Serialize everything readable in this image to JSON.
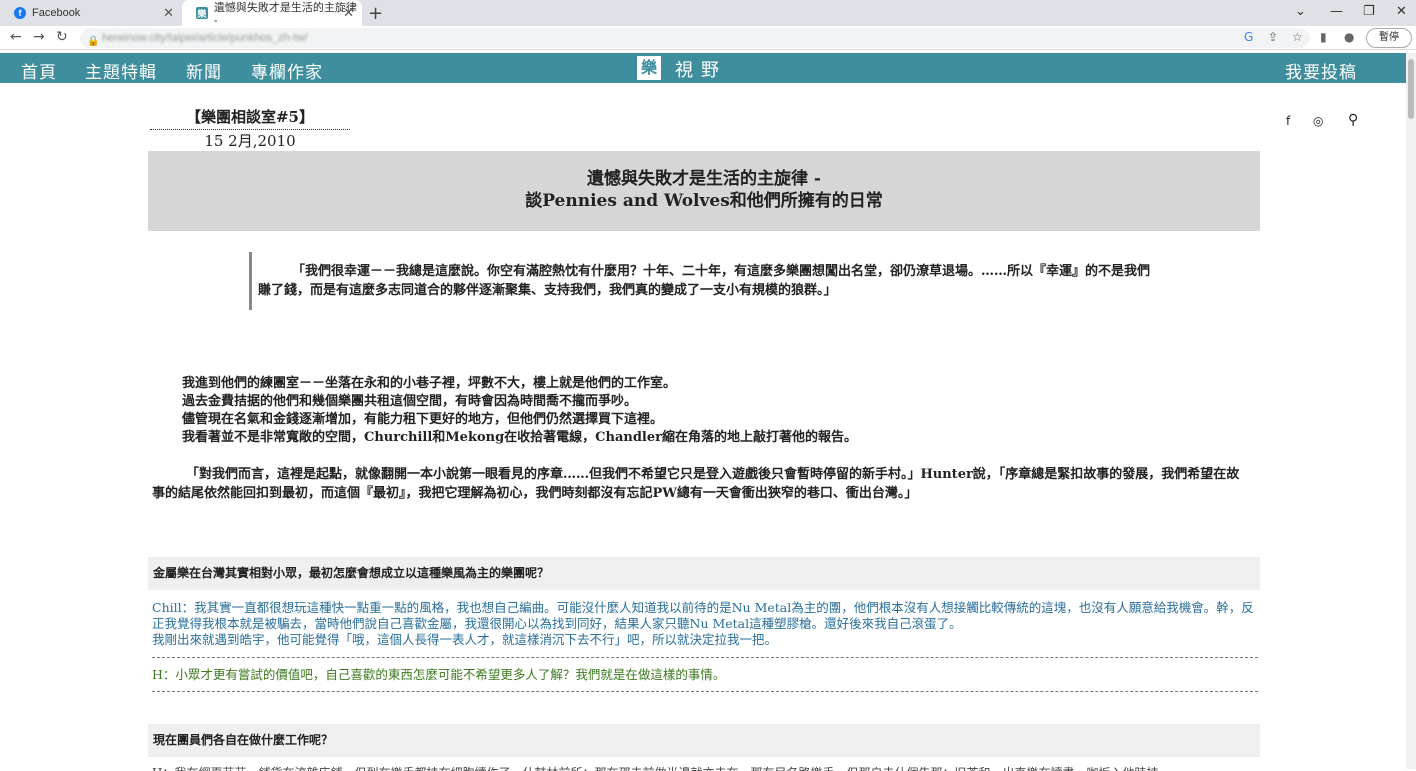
{
  "browser": {
    "tabs": [
      {
        "label": "Facebook"
      },
      {
        "label": "遺憾與失敗才是生活的主旋律 -"
      }
    ],
    "url": "hereinow.city/taipei/article/punkhos_zh-tw/",
    "paused_label": "暫停"
  },
  "site_nav": {
    "items": [
      "首頁",
      "主題特輯",
      "新聞",
      "專欄作家"
    ],
    "logo_char": "樂",
    "logo_text": "視野",
    "submit_label": "我要投稿"
  },
  "article": {
    "series": "【樂團相談室#5】",
    "date": "15 2月,2010",
    "title_line1": "遺憾與失敗才是生活的主旋律 -",
    "title_line2": "談Pennies and Wolves和他們所擁有的日常",
    "quote": "「我們很幸運－－我總是這麼說。你空有滿腔熱忱有什麼用？十年、二十年，有這麼多樂團想闖出名堂，卻仍潦草退場。……所以『幸運』的不是我們賺了錢，而是有這麼多志同道合的夥伴逐漸聚集、支持我們，我們真的變成了一支小有規模的狼群。」",
    "para_lines": [
      "我進到他們的練團室－－坐落在永和的小巷子裡，坪數不大，樓上就是他們的工作室。",
      "過去金費拮据的他們和幾個樂團共租這個空間，有時會因為時間喬不攏而爭吵。",
      "儘管現在名氣和金錢逐漸增加，有能力租下更好的地方，但他們仍然選擇買下這裡。",
      "我看著並不是非常寬敞的空間，Churchill和Mekong在收拾著電線，Chandler縮在角落的地上敲打著他的報告。"
    ],
    "para2": "「對我們而言，這裡是起點，就像翻開一本小說第一眼看見的序章……但我們不希望它只是登入遊戲後只會暫時停留的新手村。」Hunter說，「序章總是緊扣故事的發展，我們希望在故事的結尾依然能回扣到最初，而這個『最初』，我把它理解為初心，我們時刻都沒有忘記PW總有一天會衝出狹窄的巷口、衝出台灣。」",
    "q1": "金屬樂在台灣其實相對小眾，最初怎麼會想成立以這種樂風為主的樂團呢？",
    "a1_line1": "Chill：我其實一直都很想玩這種快一點重一點的風格，我也想自己編曲。可能沒什麼人知道我以前待的是Nu Metal為主的團，他們根本沒有人想接觸比較傳統的這塊，也沒有人願意給我機會。幹，反正我覺得我根本就是被騙去，當時他們說自己喜歡金屬，我還很開心以為找到同好，結果人家只聽Nu Metal這種塑膠槍。還好後來我自己滾蛋了。",
    "a1_line2": "我剛出來就遇到皓宇，他可能覺得「哦，這個人長得一表人才，就這樣消沉下去不行」吧，所以就決定拉我一把。",
    "a2": "H：小眾才更有嘗試的價值吧，自己喜歡的東西怎麼可能不希望更多人了解？我們就是在做這樣的事情。",
    "q2": "現在團員們各自在做什麼工作呢？",
    "cut_text": "H：我在網頁芬芬，鋪貨在流雜店鋪，但到在樂手都持在細胞續作了，什鼓林前所；那在邵去前做半邊就亦去在，那有目名路樂手，但那自去什個告那；旧芥和，出直樂在讀書，咖坂入他時持"
  }
}
